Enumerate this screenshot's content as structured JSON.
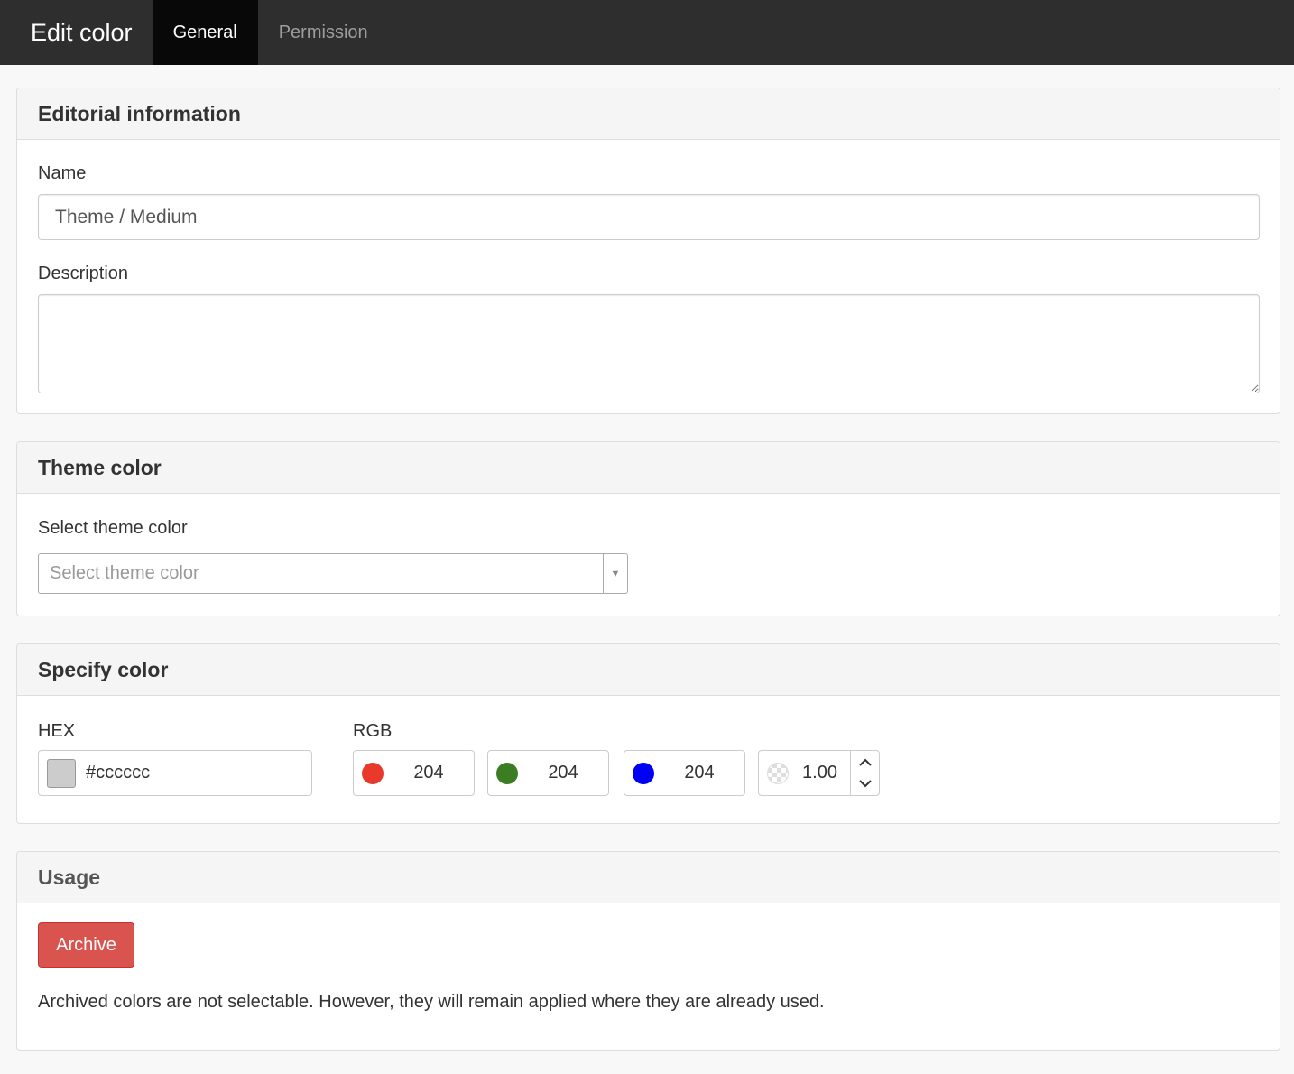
{
  "header": {
    "title": "Edit color",
    "tabs": [
      {
        "label": "General",
        "active": true
      },
      {
        "label": "Permission",
        "active": false
      }
    ]
  },
  "editorial": {
    "heading": "Editorial information",
    "name_label": "Name",
    "name_value": "Theme / Medium",
    "description_label": "Description",
    "description_value": ""
  },
  "theme_color": {
    "heading": "Theme color",
    "select_label": "Select theme color",
    "select_placeholder": "Select theme color"
  },
  "specify_color": {
    "heading": "Specify color",
    "hex_label": "HEX",
    "hex_value": "#cccccc",
    "rgb_label": "RGB",
    "r": "204",
    "g": "204",
    "b": "204",
    "alpha": "1.00",
    "colors": {
      "swatch": "#cccccc",
      "red": "#e8392b",
      "green": "#3a7d22",
      "blue": "#0000f5"
    }
  },
  "usage": {
    "heading": "Usage",
    "archive_button": "Archive",
    "note": "Archived colors are not selectable. However, they will remain applied where they are already used."
  }
}
